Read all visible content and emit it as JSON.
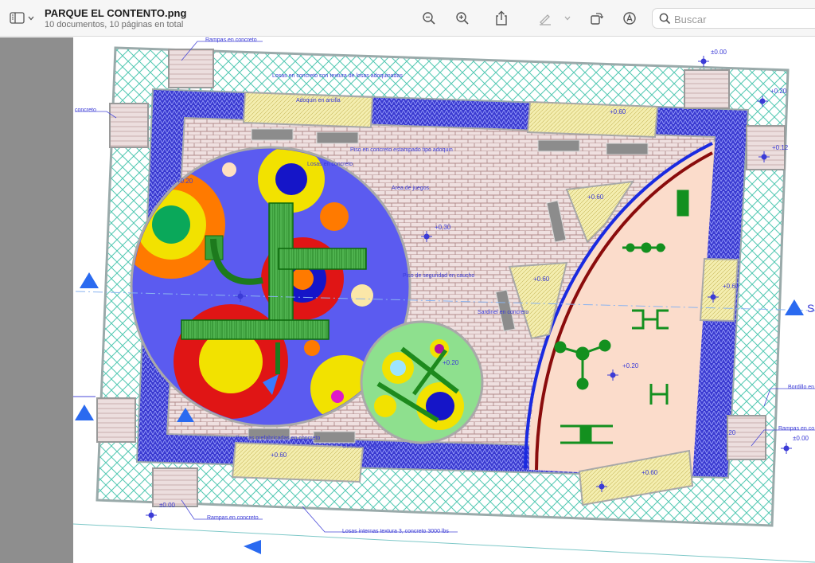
{
  "toolbar": {
    "doc_title": "PARQUE EL CONTENTO.png",
    "doc_subtitle": "10 documentos, 10 páginas en total",
    "search_placeholder": "Buscar"
  },
  "icons": [
    "sidebar-toggle-icon",
    "chevron-down-icon",
    "zoom-out-icon",
    "zoom-in-icon",
    "share-icon",
    "highlight-pen-icon",
    "rotate-icon",
    "markup-icon",
    "search-icon"
  ],
  "plan": {
    "ramp_labels": {
      "top": "Rampas en concreto",
      "left": "concreto",
      "bottom": "Rampas en concreto",
      "right": "Rampas en co"
    },
    "bottom_note": "Losas internas textura 3, concreto 3000 lbs",
    "right_note": "Bordillo en",
    "levels": {
      "top_right": "±0.00",
      "right_1": "+0.20",
      "right_2": "+0.12",
      "left_20": "+0.20",
      "center": "+0.30",
      "mid_60a": "+0.60",
      "mid_60b": "+0.60",
      "mid_60c": "+0.60",
      "mid_60d": "+0.60",
      "right_60": "+0.60",
      "right_20": "+0.20",
      "small_20": "+0.20",
      "bottom_60": "+0.60",
      "bottom_left": "±0.00",
      "right_edge": "±0.00",
      "bottom_right_20": "+0.20",
      "section_mark": "S"
    },
    "text_lines": {
      "l1": "Losas en concreto con textura de losas adoquinadas",
      "l2": "Adoquin en arcilla",
      "l3": "Piso en concreto estampado tipo adoquin",
      "l4": "Losas en concreto",
      "l5": "Area de juegos",
      "l6": "Piso de seguridad en caucho",
      "l7": "Sardinel en concreto",
      "l8": "Gimnasio al aire libre",
      "l9": "Bancas prefabricadas en concreto"
    }
  }
}
